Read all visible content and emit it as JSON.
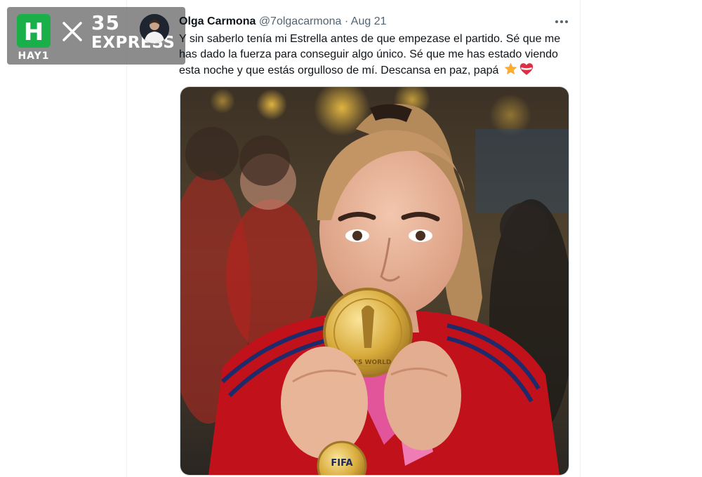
{
  "watermark": {
    "logo_letter": "H",
    "brand_label": "HAY1",
    "separator": "×",
    "partner_number": "35",
    "partner_name": "EXPRESS"
  },
  "tweet": {
    "author_name": "Olga Carmona",
    "author_handle": "@7olgacarmona",
    "separator": "·",
    "date": "Aug 21",
    "text": "Y sin saberlo tenía mi Estrella antes de que empezase el partido. Sé que me has dado la fuerza para conseguir algo único. Sé que me has estado viendo esta noche y que estás orgulloso de mí. Descansa en paz, papá",
    "emojis": [
      "star-emoji",
      "heart-with-ribbon-emoji"
    ],
    "more_icon": "more-dots-icon"
  },
  "photo": {
    "medal_text": "WOMEN'S WORLD CUP",
    "medal_brand": "FIFA"
  },
  "colors": {
    "text_primary": "#0f1419",
    "text_secondary": "#536471",
    "border": "#eff3f4",
    "brand_green": "#19b04a",
    "jersey_red": "#c1121c",
    "medal_gold": "#d4a93a"
  }
}
